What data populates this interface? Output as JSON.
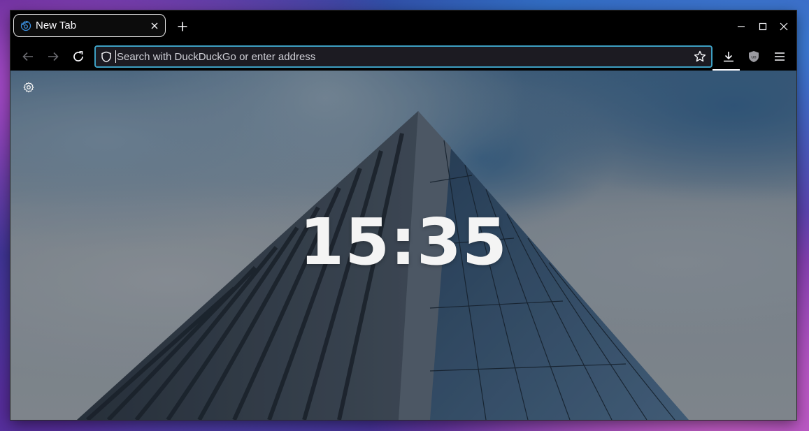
{
  "tab": {
    "title": "New Tab"
  },
  "urlbar": {
    "placeholder": "Search with DuckDuckGo or enter address"
  },
  "newtab": {
    "clock": "15:35"
  },
  "colors": {
    "urlbar_focus": "#3d9fc2",
    "chrome_bg": "#000000",
    "text": "#fbfbfe"
  },
  "icons": {
    "tab_favicon": "firefox-icon",
    "toolbar": [
      "back-icon",
      "forward-icon",
      "reload-icon",
      "shield-icon",
      "star-icon",
      "download-icon",
      "ublock-icon",
      "menu-icon"
    ],
    "window": [
      "minimize-icon",
      "maximize-icon",
      "close-icon"
    ],
    "content": [
      "gear-icon"
    ]
  }
}
